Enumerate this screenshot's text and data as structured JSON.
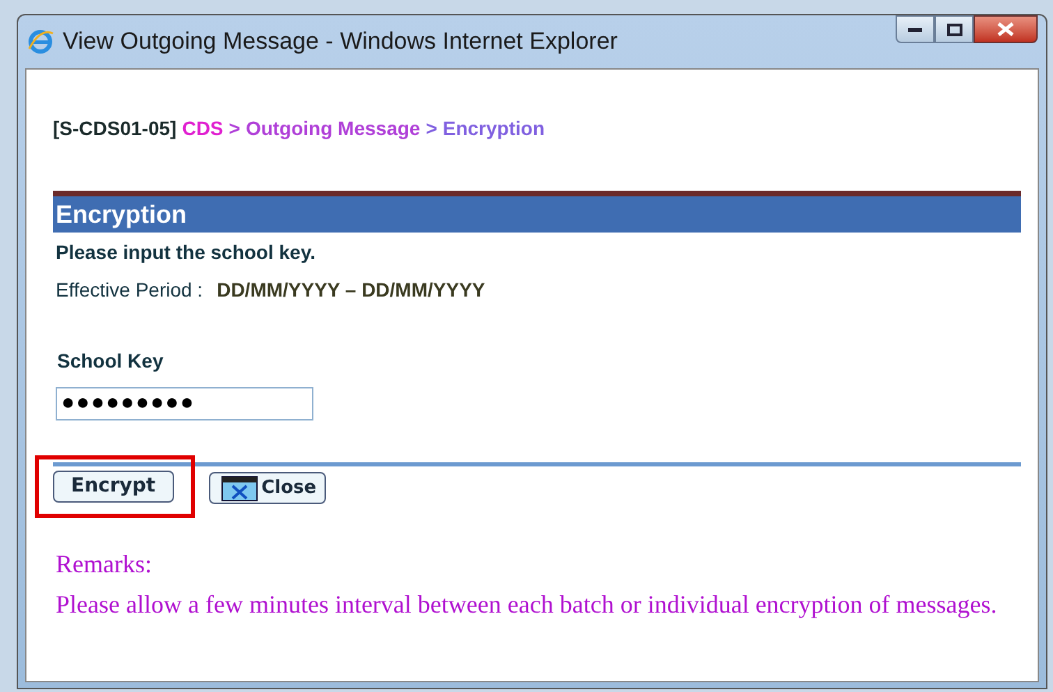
{
  "window": {
    "title": "View Outgoing Message - Windows Internet Explorer"
  },
  "breadcrumb": {
    "code": "[S-CDS01-05]",
    "items": [
      {
        "label": "CDS",
        "color": "#e020d0"
      },
      {
        "label": "Outgoing Message",
        "color": "#b040d8"
      },
      {
        "label": "Encryption",
        "color": "#8060e0"
      }
    ],
    "separator": ">"
  },
  "section": {
    "title": "Encryption",
    "instruction": "Please input the school key.",
    "period_label": "Effective Period :",
    "period_value": "DD/MM/YYYY – DD/MM/YYYY"
  },
  "school_key": {
    "label": "School Key",
    "value": "●●●●●●●●●"
  },
  "buttons": [
    {
      "kind": "plain",
      "label": "Encrypt",
      "highlighted": true
    },
    {
      "kind": "close",
      "label": "Close",
      "highlighted": false
    }
  ],
  "remarks": {
    "title": "Remarks:",
    "text": "Please allow a few minutes interval between each batch or individual encryption of messages."
  }
}
